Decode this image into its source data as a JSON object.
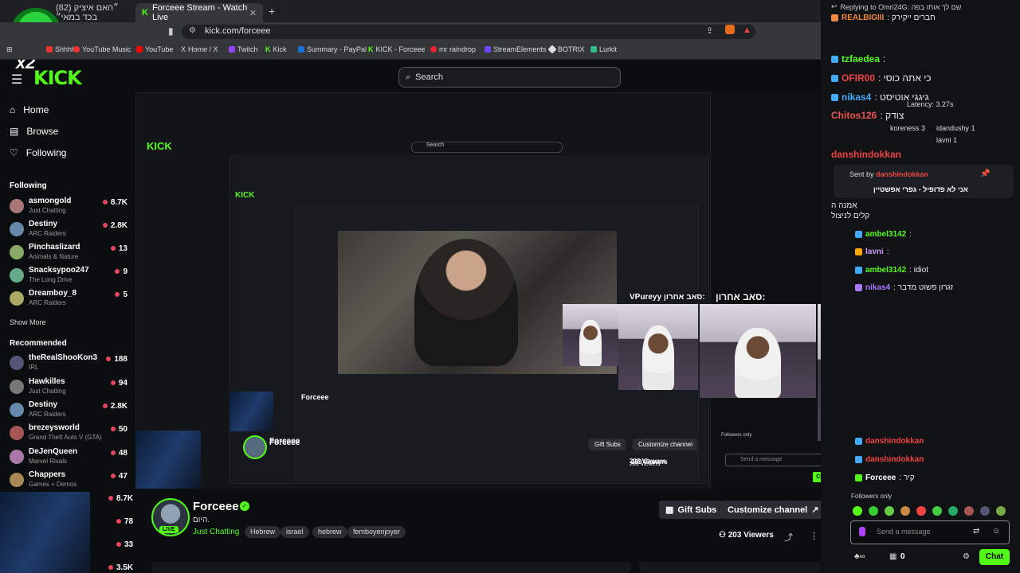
{
  "browser": {
    "tabs": [
      {
        "label": "(82) ״האם איציק בכד במאי״"
      },
      {
        "label": "Forceee Stream - Watch Live",
        "active": true
      }
    ],
    "new_tab": "+",
    "url": "kick.com/forceee",
    "bookmarks": [
      {
        "label": "Shhhh",
        "color": "#e33"
      },
      {
        "label": "YouTube Music",
        "color": "#f33"
      },
      {
        "label": "YouTube",
        "color": "#f00"
      },
      {
        "label": "Home / X",
        "color": "#fff"
      },
      {
        "label": "Twitch",
        "color": "#9146ff"
      },
      {
        "label": "Kick",
        "color": "#53fc18"
      },
      {
        "label": "Summary - PayPal",
        "color": "#1b6fd8"
      },
      {
        "label": "KICK - Forceee",
        "color": "#53fc18"
      },
      {
        "label": "mr raindrop",
        "color": "#e23"
      },
      {
        "label": "StreamElements",
        "color": "#6d48ff"
      },
      {
        "label": "BOTRIX",
        "color": "#ddd"
      },
      {
        "label": "Lurkit",
        "color": "#3b8"
      }
    ]
  },
  "overlay": {
    "multiplier": "x2"
  },
  "header": {
    "logo": "KICK",
    "search_placeholder": "Search"
  },
  "sidebar": {
    "nav": [
      {
        "label": "Home",
        "icon": "home-icon"
      },
      {
        "label": "Browse",
        "icon": "browse-icon"
      },
      {
        "label": "Following",
        "icon": "heart-icon"
      }
    ],
    "following_title": "Following",
    "following": [
      {
        "name": "asmongold",
        "game": "Just Chatting",
        "viewers": "8.7K",
        "color": "#a77"
      },
      {
        "name": "Destiny",
        "game": "ARC Raiders",
        "viewers": "2.8K",
        "color": "#68a"
      },
      {
        "name": "Pinchaslizard",
        "game": "Animals & Nature",
        "viewers": "13",
        "color": "#8a6"
      },
      {
        "name": "Snacksypoo247",
        "game": "The Long Drive",
        "viewers": "9",
        "color": "#6a8"
      },
      {
        "name": "Dreamboy_8",
        "game": "ARC Raiders",
        "viewers": "5",
        "color": "#aa6"
      }
    ],
    "show_more": "Show More",
    "recommended_title": "Recommended",
    "recommended": [
      {
        "name": "theRealShooKon3",
        "game": "IRL",
        "viewers": "188",
        "color": "#557"
      },
      {
        "name": "Hawkilles",
        "game": "Just Chatting",
        "viewers": "94",
        "color": "#777"
      },
      {
        "name": "Destiny",
        "game": "ARC Raiders",
        "viewers": "2.8K",
        "color": "#68a"
      },
      {
        "name": "brezeysworld",
        "game": "Grand Theft Auto V (GTA)",
        "viewers": "50",
        "color": "#a55"
      },
      {
        "name": "DeJenQueen",
        "game": "Marvel Rivals",
        "viewers": "48",
        "color": "#a7a"
      },
      {
        "name": "Chappers",
        "game": "Games + Demos",
        "viewers": "47",
        "color": "#a85"
      }
    ],
    "overflow_counts": [
      "8.7K",
      "78",
      "33",
      "3.5K"
    ]
  },
  "stream": {
    "channel": "Forceee",
    "title": "היום.",
    "category": "Just Chatting",
    "tags": [
      "Hebrew",
      "israel",
      "hebrew",
      "femboyenjoyer"
    ],
    "live": "LIVE",
    "viewers": "203 Viewers",
    "gift_subs": "Gift Subs",
    "customize": "Customize channel",
    "cam_name": "VPureyy",
    "cam_caption": "סאב אחרון:",
    "mini_search": "Search",
    "mini_channel": "Forceee",
    "mini_viewers": "203 Viewers",
    "mini_gift": "Gift Subs",
    "mini_customize": "Customize channel",
    "mini_send": "Send a message",
    "mini_chat": "Chat",
    "mini_followers": "Followers only"
  },
  "chat": {
    "reply_label": "Replying to Omri24G: שם לך אותו בפה",
    "lines": [
      {
        "user": "REALBIGIII",
        "text": ": חברים ייקירק",
        "color": "#e84"
      },
      {
        "user": "tzfaedea",
        "text": ":",
        "color": "#53fc18"
      },
      {
        "user": "OFIR00",
        "text": ": כי אתה כוסי",
        "color": "#e44"
      },
      {
        "user": "nikas4",
        "text": ": גיגגי אוטיסט",
        "color": "#4af"
      },
      {
        "user": "Chitos126",
        "text": ": צודק",
        "color": "#e55"
      },
      {
        "user": "danshindokkan",
        "text": "",
        "color": "#e44"
      }
    ],
    "latency": "Latency: 3.27s",
    "viewer_list": [
      {
        "name": "koreness",
        "count": "3"
      },
      {
        "name": "idandushy",
        "count": "1"
      },
      {
        "name": "lavni",
        "count": "1"
      }
    ],
    "pinned_by": "Sent by",
    "pinned_user": "danshindokkan",
    "pinned_text": "אני לא פדופיל - גפרי אפשטיין",
    "lower_lines": [
      {
        "user": "",
        "text": "אמנה ה",
        "color": "#fff"
      },
      {
        "user": "",
        "text": "קלים לניצול",
        "color": "#fff"
      },
      {
        "user": "ambel3142",
        "text": ":",
        "color": "#53fc18"
      },
      {
        "user": "lavni",
        "text": ":",
        "color": "#c9f"
      },
      {
        "user": "ambel3142",
        "text": ": idiot",
        "color": "#53fc18"
      },
      {
        "user": "nikas4",
        "text": ": זגרון פשוט מדבר",
        "color": "#a7f"
      }
    ],
    "bottom_lines": [
      {
        "user": "danshindokkan",
        "text": "",
        "color": "#e44"
      },
      {
        "user": "danshindokkan",
        "text": "",
        "color": "#e44"
      },
      {
        "user": "Forceee",
        "text": ": קיר",
        "color": "#fff"
      }
    ],
    "followers_only": "Followers only",
    "placeholder": "Send a message",
    "points": "0",
    "send_label": "Chat"
  }
}
